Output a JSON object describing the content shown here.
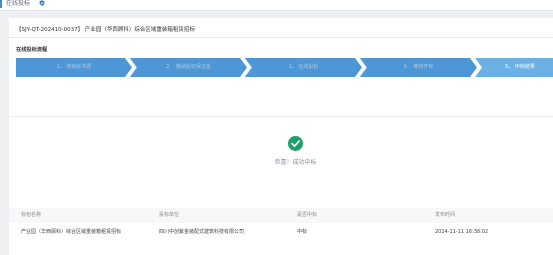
{
  "topbar": {
    "label": "在线投标"
  },
  "project": {
    "title": "【SJY-QT-202410-0037】 产业园（华西顾科）综合区域重装箱租赁招标"
  },
  "process": {
    "section_title": "在线投标流程",
    "steps": [
      {
        "label": "1、 缴纳标书费"
      },
      {
        "label": "2、 缴纳投标保证金"
      },
      {
        "label": "3、 在线投标"
      },
      {
        "label": "4、 等待开标"
      },
      {
        "label": "5、 中标结果"
      }
    ],
    "active_step": 5,
    "colors": {
      "inactive": "#4d97d6",
      "active": "#6cb1e6"
    }
  },
  "result": {
    "icon": "check-circle-icon",
    "icon_color": "#1fa06b",
    "message": "恭喜！成功中标"
  },
  "table": {
    "headers": [
      "标包名称",
      "投标单位",
      "是否中标",
      "发布时间"
    ],
    "rows": [
      [
        "产业园（华西顾科）综合区域重装箱租赁招标",
        "四川中创紫金装配式建筑科技有限公司",
        "中标",
        "2024-11-11 16:38:02"
      ]
    ]
  }
}
